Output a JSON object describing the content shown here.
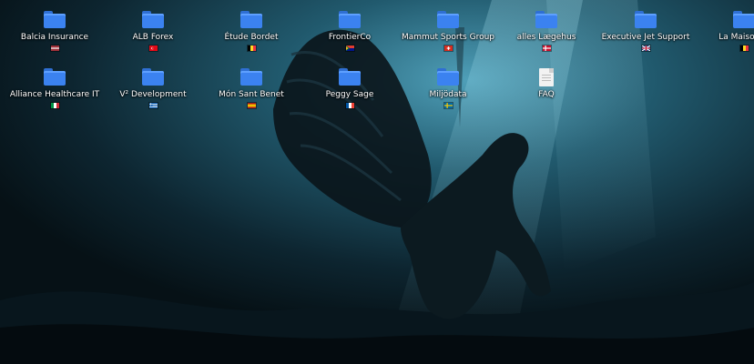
{
  "desktop": {
    "wallpaper_description": "",
    "icons": [
      {
        "label": "Balcia Insurance",
        "type": "folder",
        "flag": "latvia"
      },
      {
        "label": "ALB Forex",
        "type": "folder",
        "flag": "turkey"
      },
      {
        "label": "Étude Bordet",
        "type": "folder",
        "flag": "belgium"
      },
      {
        "label": "FrontierCo",
        "type": "folder",
        "flag": "south-africa"
      },
      {
        "label": "Mammut Sports Group",
        "type": "folder",
        "flag": "switzerland"
      },
      {
        "label": "alles Lægehus",
        "type": "folder",
        "flag": "denmark"
      },
      {
        "label": "Executive Jet Support",
        "type": "folder",
        "flag": "united-kingdom"
      },
      {
        "label": "La Maison Li",
        "type": "folder",
        "flag": "belgium"
      },
      {
        "label": "Alliance Healthcare IT",
        "type": "folder",
        "flag": "italy"
      },
      {
        "label": "V² Development",
        "type": "folder",
        "flag": "greece"
      },
      {
        "label": "Món Sant Benet",
        "type": "folder",
        "flag": "spain"
      },
      {
        "label": "Peggy Sage",
        "type": "folder",
        "flag": "france"
      },
      {
        "label": "Miljödata",
        "type": "folder",
        "flag": "sweden"
      },
      {
        "label": "FAQ",
        "type": "document",
        "flag": ""
      }
    ]
  },
  "colors": {
    "folder": "#3b82f0",
    "wallpaper_light": "#3f8fa8",
    "wallpaper_dark": "#06121a"
  }
}
